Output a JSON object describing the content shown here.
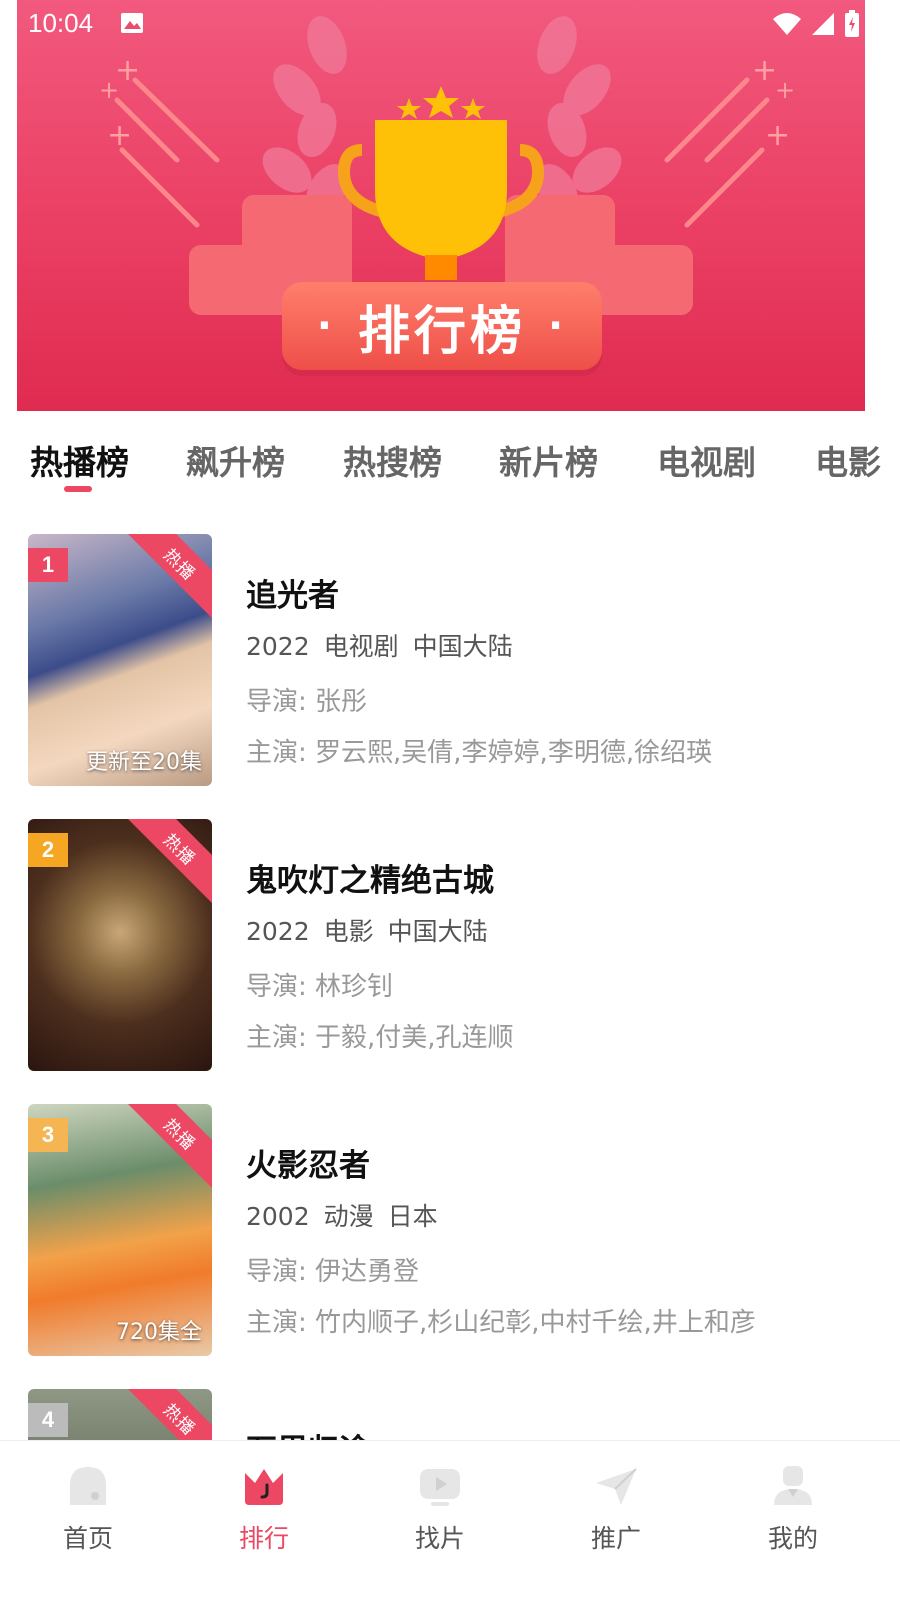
{
  "status_bar": {
    "time": "10:04"
  },
  "banner": {
    "title": "排行榜",
    "colors": {
      "primary": "#ec4763",
      "trophy": "#ffc107"
    }
  },
  "tabs": [
    {
      "label": "热播榜",
      "active": true
    },
    {
      "label": "飙升榜",
      "active": false
    },
    {
      "label": "热搜榜",
      "active": false
    },
    {
      "label": "新片榜",
      "active": false
    },
    {
      "label": "电视剧",
      "active": false
    },
    {
      "label": "电影",
      "active": false
    }
  ],
  "list": [
    {
      "rank": "1",
      "rank_color": "#ec4763",
      "tag": "热播",
      "poster_overlay": "更新至20集",
      "title": "追光者",
      "year": "2022",
      "type": "电视剧",
      "region": "中国大陆",
      "director_label": "导演:",
      "director": "张彤",
      "cast_label": "主演:",
      "cast": "罗云熙,吴倩,李婷婷,李明德,徐绍瑛"
    },
    {
      "rank": "2",
      "rank_color": "#f5a623",
      "tag": "热播",
      "poster_overlay": "",
      "title": "鬼吹灯之精绝古城",
      "year": "2022",
      "type": "电影",
      "region": "中国大陆",
      "director_label": "导演:",
      "director": "林珍钊",
      "cast_label": "主演:",
      "cast": "于毅,付美,孔连顺"
    },
    {
      "rank": "3",
      "rank_color": "#f5b553",
      "tag": "热播",
      "poster_overlay": "720集全",
      "title": "火影忍者",
      "year": "2002",
      "type": "动漫",
      "region": "日本",
      "director_label": "导演:",
      "director": "伊达勇登",
      "cast_label": "主演:",
      "cast": "竹内顺子,杉山纪彰,中村千绘,井上和彦"
    },
    {
      "rank": "4",
      "rank_color": "#bbbbbb",
      "tag": "热播",
      "poster_overlay": "",
      "title": "万里归途",
      "year": "",
      "type": "",
      "region": "",
      "director_label": "",
      "director": "",
      "cast_label": "",
      "cast": ""
    }
  ],
  "bottom_nav": [
    {
      "label": "首页",
      "icon": "home-icon",
      "active": false
    },
    {
      "label": "排行",
      "icon": "crown-icon",
      "active": true
    },
    {
      "label": "找片",
      "icon": "video-icon",
      "active": false
    },
    {
      "label": "推广",
      "icon": "send-icon",
      "active": false
    },
    {
      "label": "我的",
      "icon": "user-icon",
      "active": false
    }
  ]
}
